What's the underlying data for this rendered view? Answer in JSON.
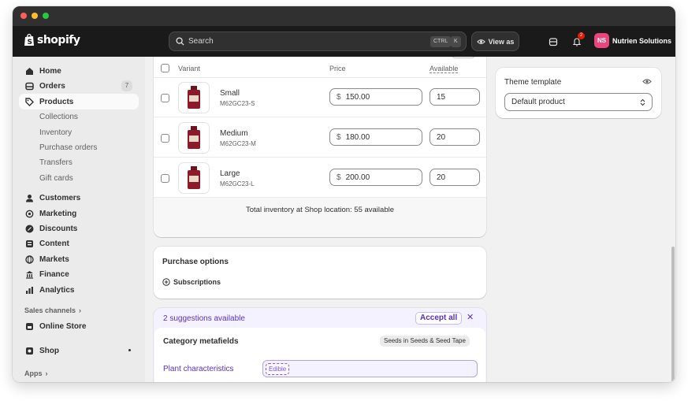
{
  "colors": {
    "accent": "#8051ff",
    "avatar": "#e8467c",
    "topbar": "#1a1a1a"
  },
  "brand": {
    "name": "shopify"
  },
  "search": {
    "label": "Search",
    "kbd1": "CTRL",
    "kbd2": "K"
  },
  "topbar": {
    "view_as": "View as",
    "notification_count": "2",
    "avatar_initials": "NS",
    "store_name": "Nutrien Solutions"
  },
  "sidebar": {
    "items": [
      {
        "label": "Home",
        "icon": "home-icon"
      },
      {
        "label": "Orders",
        "icon": "orders-icon",
        "count": "7"
      },
      {
        "label": "Products",
        "icon": "tag-icon",
        "active": true
      },
      {
        "label": "Collections",
        "sub": true
      },
      {
        "label": "Inventory",
        "sub": true
      },
      {
        "label": "Purchase orders",
        "sub": true
      },
      {
        "label": "Transfers",
        "sub": true
      },
      {
        "label": "Gift cards",
        "sub": true
      },
      {
        "label": "Customers",
        "icon": "person-icon"
      },
      {
        "label": "Marketing",
        "icon": "target-icon"
      },
      {
        "label": "Discounts",
        "icon": "discount-icon"
      },
      {
        "label": "Content",
        "icon": "content-icon"
      },
      {
        "label": "Markets",
        "icon": "globe-icon"
      },
      {
        "label": "Finance",
        "icon": "bank-icon"
      },
      {
        "label": "Analytics",
        "icon": "chart-icon"
      }
    ],
    "sales_channels_label": "Sales channels",
    "online_store": "Online Store",
    "shop": "Shop",
    "apps_label": "Apps"
  },
  "variants": {
    "headers": {
      "variant": "Variant",
      "price": "Price",
      "available": "Available"
    },
    "currency": "$",
    "rows": [
      {
        "name": "Small",
        "sku": "M62GC23-S",
        "price": "150.00",
        "available": "15"
      },
      {
        "name": "Medium",
        "sku": "M62GC23-M",
        "price": "180.00",
        "available": "20"
      },
      {
        "name": "Large",
        "sku": "M62GC23-L",
        "price": "200.00",
        "available": "20"
      }
    ],
    "total": "Total inventory at Shop location: 55 available"
  },
  "purchase_options": {
    "title": "Purchase options",
    "subscriptions": "Subscriptions"
  },
  "suggestions": {
    "text": "2 suggestions available",
    "accept_all": "Accept all",
    "category_metafields": "Category metafields",
    "category_pill": "Seeds in Seeds & Seed Tape",
    "field_label": "Plant characteristics",
    "field_value": "Edible"
  },
  "theme": {
    "label": "Theme template",
    "value": "Default product"
  }
}
